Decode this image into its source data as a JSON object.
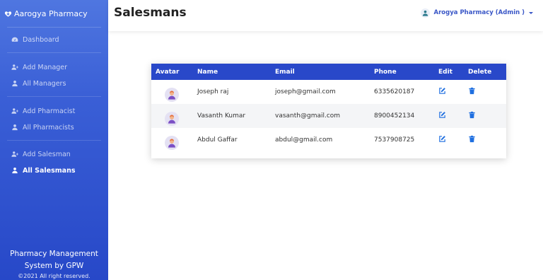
{
  "app": {
    "brand": "Aarogya Pharmacy",
    "page_title": "Salesmans",
    "user_label": "Arogya Pharmacy (Admin )"
  },
  "sidebar": {
    "items": [
      {
        "label": "Dashboard",
        "icon": "gauge-icon",
        "active": false
      },
      {
        "label": "Add Manager",
        "icon": "user-plus-icon",
        "active": false
      },
      {
        "label": "All Managers",
        "icon": "user-icon",
        "active": false
      },
      {
        "label": "Add Pharmacist",
        "icon": "user-plus-icon",
        "active": false
      },
      {
        "label": "All Pharmacists",
        "icon": "user-icon",
        "active": false
      },
      {
        "label": "Add Salesman",
        "icon": "user-plus-icon",
        "active": false
      },
      {
        "label": "All Salesmans",
        "icon": "user-icon",
        "active": true
      }
    ],
    "footer_line1": "Pharmacy Management",
    "footer_line2": "System by GPW",
    "footer_line3": "©2021 All right reserved."
  },
  "table": {
    "headers": [
      "Avatar",
      "Name",
      "Email",
      "Phone",
      "Edit",
      "Delete"
    ],
    "rows": [
      {
        "name": "Joseph raj",
        "email": "joseph@gmail.com",
        "phone": "6335620187"
      },
      {
        "name": "Vasanth Kumar",
        "email": "vasanth@gmail.com",
        "phone": "8900452134"
      },
      {
        "name": "Abdul Gaffar",
        "email": "abdul@gmail.com",
        "phone": "7537908725"
      }
    ]
  },
  "colors": {
    "sidebar_top": "#4f76e0",
    "sidebar_bottom": "#2748c8",
    "table_header": "#2948c9",
    "action_icon": "#1f6fe0"
  }
}
